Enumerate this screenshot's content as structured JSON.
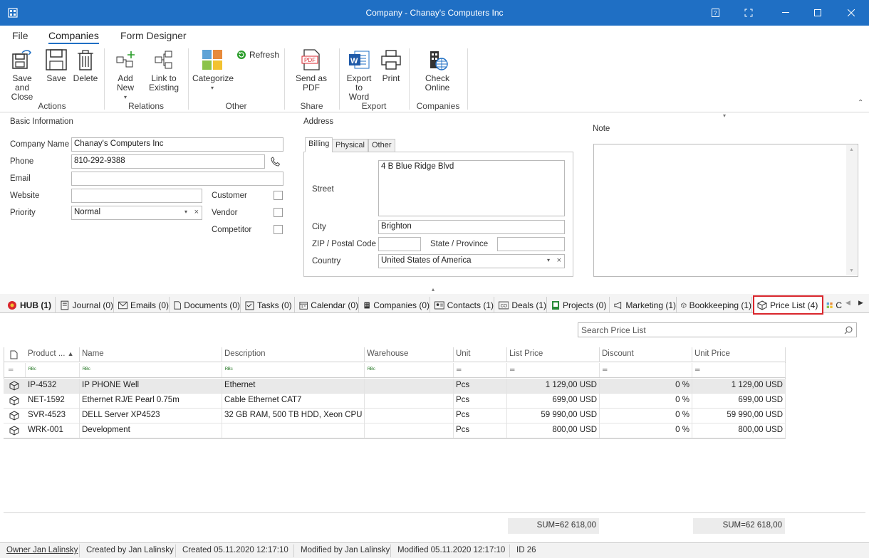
{
  "window": {
    "title": "Company - Chanay's Computers Inc"
  },
  "menu": {
    "tabs": [
      "File",
      "Companies",
      "Form Designer"
    ],
    "active": "Companies"
  },
  "ribbon": {
    "buttons": {
      "save_close": "Save and Close",
      "save": "Save",
      "delete": "Delete",
      "add_new": "Add New",
      "link_existing": "Link to Existing",
      "categorize": "Categorize",
      "refresh": "Refresh",
      "send_pdf": "Send as PDF",
      "export_word": "Export to Word",
      "print": "Print",
      "check_online": "Check Online"
    },
    "groups": {
      "actions": "Actions",
      "relations": "Relations",
      "other": "Other",
      "share": "Share",
      "export": "Export",
      "companies": "Companies"
    }
  },
  "basic_info": {
    "title": "Basic Information",
    "company_name_label": "Company Name",
    "company_name": "Chanay's Computers Inc",
    "phone_label": "Phone",
    "phone": "810-292-9388",
    "email_label": "Email",
    "email": "",
    "website_label": "Website",
    "website": "",
    "priority_label": "Priority",
    "priority": "Normal",
    "customer_label": "Customer",
    "vendor_label": "Vendor",
    "competitor_label": "Competitor"
  },
  "address": {
    "title": "Address",
    "tabs": [
      "Billing",
      "Physical",
      "Other"
    ],
    "street_label": "Street",
    "street": "4 B Blue Ridge Blvd",
    "city_label": "City",
    "city": "Brighton",
    "zip_label": "ZIP / Postal Code",
    "zip": "",
    "state_label": "State / Province",
    "state": "",
    "country_label": "Country",
    "country": "United States of America"
  },
  "note": {
    "title": "Note",
    "value": ""
  },
  "bottom_tabs": [
    "HUB (1)",
    "Journal (0)",
    "Emails (0)",
    "Documents (0)",
    "Tasks (0)",
    "Calendar (0)",
    "Companies (0)",
    "Contacts (1)",
    "Deals (1)",
    "Projects (0)",
    "Marketing (1)",
    "Bookkeeping (1)",
    "Price List (4)",
    "C"
  ],
  "price_list": {
    "search_placeholder": "Search Price List",
    "columns": [
      "Product ...",
      "Name",
      "Description",
      "Warehouse",
      "Unit",
      "List Price",
      "Discount",
      "Unit Price"
    ],
    "rows": [
      [
        "IP-4532",
        "IP PHONE Well",
        "Ethernet",
        "",
        "Pcs",
        "1 129,00 USD",
        "0 %",
        "1 129,00 USD"
      ],
      [
        "NET-1592",
        "Ethernet RJ/E Pearl 0.75m",
        "Cable Ethernet CAT7",
        "",
        "Pcs",
        "699,00 USD",
        "0 %",
        "699,00 USD"
      ],
      [
        "SVR-4523",
        "DELL Server XP4523",
        "32 GB RAM, 500 TB HDD, Xeon CPU",
        "",
        "Pcs",
        "59 990,00 USD",
        "0 %",
        "59 990,00 USD"
      ],
      [
        "WRK-001",
        "Development",
        "",
        "",
        "Pcs",
        "800,00 USD",
        "0 %",
        "800,00 USD"
      ]
    ],
    "sum_list": "SUM=62 618,00",
    "sum_unit": "SUM=62 618,00"
  },
  "status": {
    "owner": "Owner Jan Lalinsky",
    "created_by": "Created by Jan Lalinsky",
    "created": "Created 05.11.2020 12:17:10",
    "modified_by": "Modified by Jan Lalinsky",
    "modified": "Modified 05.11.2020 12:17:10",
    "id": "ID 26"
  }
}
